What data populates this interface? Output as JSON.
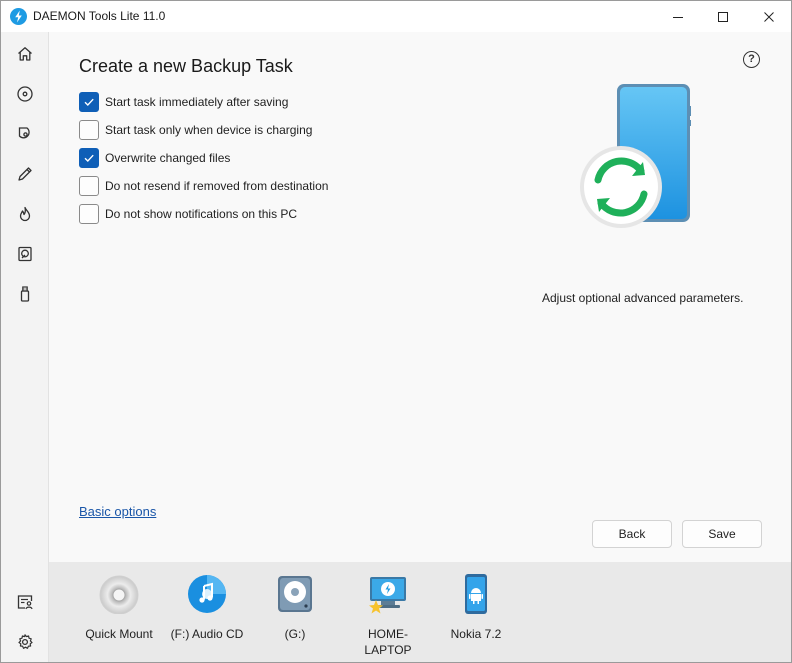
{
  "app": {
    "title": "DAEMON Tools Lite 11.0"
  },
  "colors": {
    "accent": "#0f5fb7",
    "link": "#1a56a8",
    "logo": "#1e9be3",
    "sync_green": "#1fb05a"
  },
  "sidebar": {
    "items": [
      {
        "name": "home-icon"
      },
      {
        "name": "disc-icon"
      },
      {
        "name": "image-disc-icon"
      },
      {
        "name": "pencil-icon"
      },
      {
        "name": "flame-icon"
      },
      {
        "name": "virtual-hdd-icon"
      },
      {
        "name": "usb-icon"
      },
      {
        "name": "license-user-icon"
      },
      {
        "name": "settings-gear-icon"
      }
    ]
  },
  "main": {
    "title": "Create a new Backup Task",
    "help_label": "?",
    "options": [
      {
        "label": "Start task immediately after saving",
        "checked": true
      },
      {
        "label": "Start task only when device is charging",
        "checked": false
      },
      {
        "label": "Overwrite changed files",
        "checked": true
      },
      {
        "label": "Do not resend if removed from destination",
        "checked": false
      },
      {
        "label": "Do not show notifications on this PC",
        "checked": false
      }
    ],
    "hint": "Adjust optional advanced parameters.",
    "basic_options_link": "Basic options",
    "back_label": "Back",
    "save_label": "Save"
  },
  "devices": [
    {
      "label": "Quick Mount",
      "icon": "quick-mount-icon"
    },
    {
      "label": "(F:) Audio CD",
      "icon": "audio-cd-icon"
    },
    {
      "label": "(G:)",
      "icon": "drive-icon"
    },
    {
      "label": "HOME-LAPTOP",
      "icon": "laptop-icon"
    },
    {
      "label": "Nokia 7.2",
      "icon": "android-phone-icon"
    }
  ]
}
